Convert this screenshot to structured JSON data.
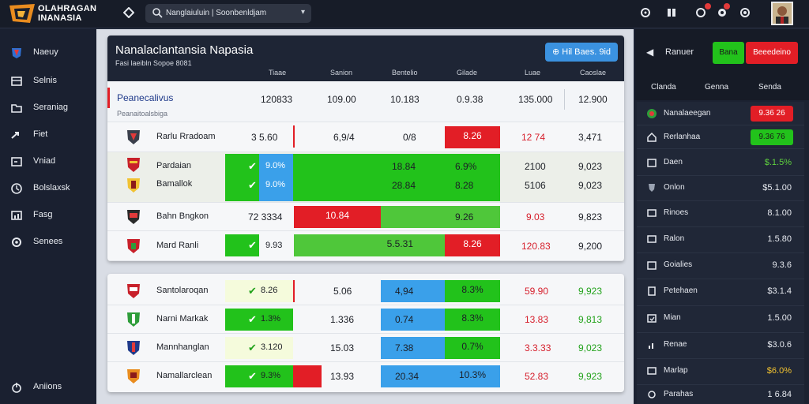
{
  "brand": {
    "line1": "OLAHRAGAN",
    "line2": "INANASIA"
  },
  "search": {
    "value": "Nanglaiuluin | Soonbenldjam",
    "placeholder": "Nanglaiuluin | Soonbenldjam"
  },
  "header_icons": [
    "home-icon",
    "chat-icon",
    "book-icon",
    "notification-icon",
    "alert-icon",
    "settings-icon"
  ],
  "sidebar": {
    "items": [
      {
        "label": "Naeuy",
        "icon": "team-icon"
      },
      {
        "label": "Selnis",
        "icon": "table-icon"
      },
      {
        "label": "Seraniag",
        "icon": "folder-icon"
      },
      {
        "label": "Fiet",
        "icon": "arrow-icon"
      },
      {
        "label": "Vniad",
        "icon": "screen-icon"
      },
      {
        "label": "Bolslaxsk",
        "icon": "clock-icon"
      },
      {
        "label": "Fasg",
        "icon": "chart-icon"
      },
      {
        "label": "Senees",
        "icon": "gear-icon"
      }
    ],
    "footer": "Aniions"
  },
  "card1": {
    "title": "Nanalaclantansia Napasia",
    "subtitle": "Fasi laeibln Sopoe 8081",
    "button": "Hil Baes. 9id",
    "columns": [
      "Tiaae",
      "Sanion",
      "Bentelio",
      "Gilade",
      "Luae",
      "Caoslae"
    ],
    "highlight": {
      "title": "Peanecalivus",
      "subtitle": "Peanaitoalsbiga",
      "values": [
        "120833",
        "109.00",
        "10.183",
        "0.9.38",
        "135.000",
        "12.900"
      ]
    },
    "rows": [
      {
        "team": "Rarlu Rradoam",
        "cells": [
          "3 5.60",
          "6,9/4",
          "0/8",
          "8.26",
          "12 74",
          "3,471"
        ]
      },
      {
        "team": "Pardaian",
        "cells": [
          "9.0%",
          "",
          "18.84",
          "6.9%",
          "2100",
          "9,023"
        ]
      },
      {
        "team": "Bamallok",
        "cells": [
          "9.0%",
          "",
          "28.84",
          "8.28",
          "5106",
          "9,023"
        ]
      },
      {
        "team": "Bahn Bngkon",
        "cells": [
          "72 3334",
          "10.84",
          "",
          "9.26",
          "9.03",
          "9,823"
        ]
      },
      {
        "team": "Mard Ranli",
        "cells": [
          "9.93",
          "5.5.31",
          "",
          "8.26",
          "120.83",
          "9,200"
        ]
      }
    ]
  },
  "card2": {
    "rows": [
      {
        "team": "Santolaroqan",
        "cells": [
          "8.26",
          "5.06",
          "4,94",
          "8.3%",
          "59.90",
          "9,923"
        ]
      },
      {
        "team": "Narni Markak",
        "cells": [
          "1.3%",
          "1.336",
          "0.74",
          "8.3%",
          "13.83",
          "9,813"
        ]
      },
      {
        "team": "Mannhanglan",
        "cells": [
          "3.120",
          "15.03",
          "7.38",
          "0.7%",
          "3.3.33",
          "9,023"
        ]
      },
      {
        "team": "Namallarclean",
        "cells": [
          "9.3%",
          "13.93",
          "20.34",
          "10.3%",
          "52.83",
          "9,923"
        ]
      }
    ]
  },
  "right": {
    "label": "Ranuer",
    "btn_green": "Bana",
    "btn_red": "Beeedeino",
    "columns": [
      "Clanda",
      "Genna",
      "Senda"
    ],
    "rows": [
      {
        "label": "Nanalaeegan",
        "value": "9.36 26",
        "style": "red"
      },
      {
        "label": "Rerlanhaa",
        "value": "9.36 76",
        "style": "green"
      },
      {
        "label": "Daen",
        "value": "$.1.5%",
        "style": "lime"
      },
      {
        "label": "Onlon",
        "value": "$5.1.00",
        "style": "plain"
      },
      {
        "label": "Rinoes",
        "value": "8.1.00",
        "style": "plain"
      },
      {
        "label": "Ralon",
        "value": "1.5.80",
        "style": "plain"
      },
      {
        "label": "Goialies",
        "value": "9.3.6",
        "style": "plain"
      },
      {
        "label": "Petehaen",
        "value": "$3.1.4",
        "style": "plain"
      },
      {
        "label": "Mian",
        "value": "1.5.00",
        "style": "plain"
      },
      {
        "label": "Renae",
        "value": "$3.0.6",
        "style": "plain"
      },
      {
        "label": "Marlap",
        "value": "$6.0%",
        "style": "yellow"
      },
      {
        "label": "Parahas",
        "value": "1 6.84",
        "style": "plain"
      }
    ]
  },
  "colors": {
    "green": "#22c21b",
    "red": "#e21e26",
    "blue": "#3aa0ea",
    "lightgreen": "#4fc73a"
  }
}
